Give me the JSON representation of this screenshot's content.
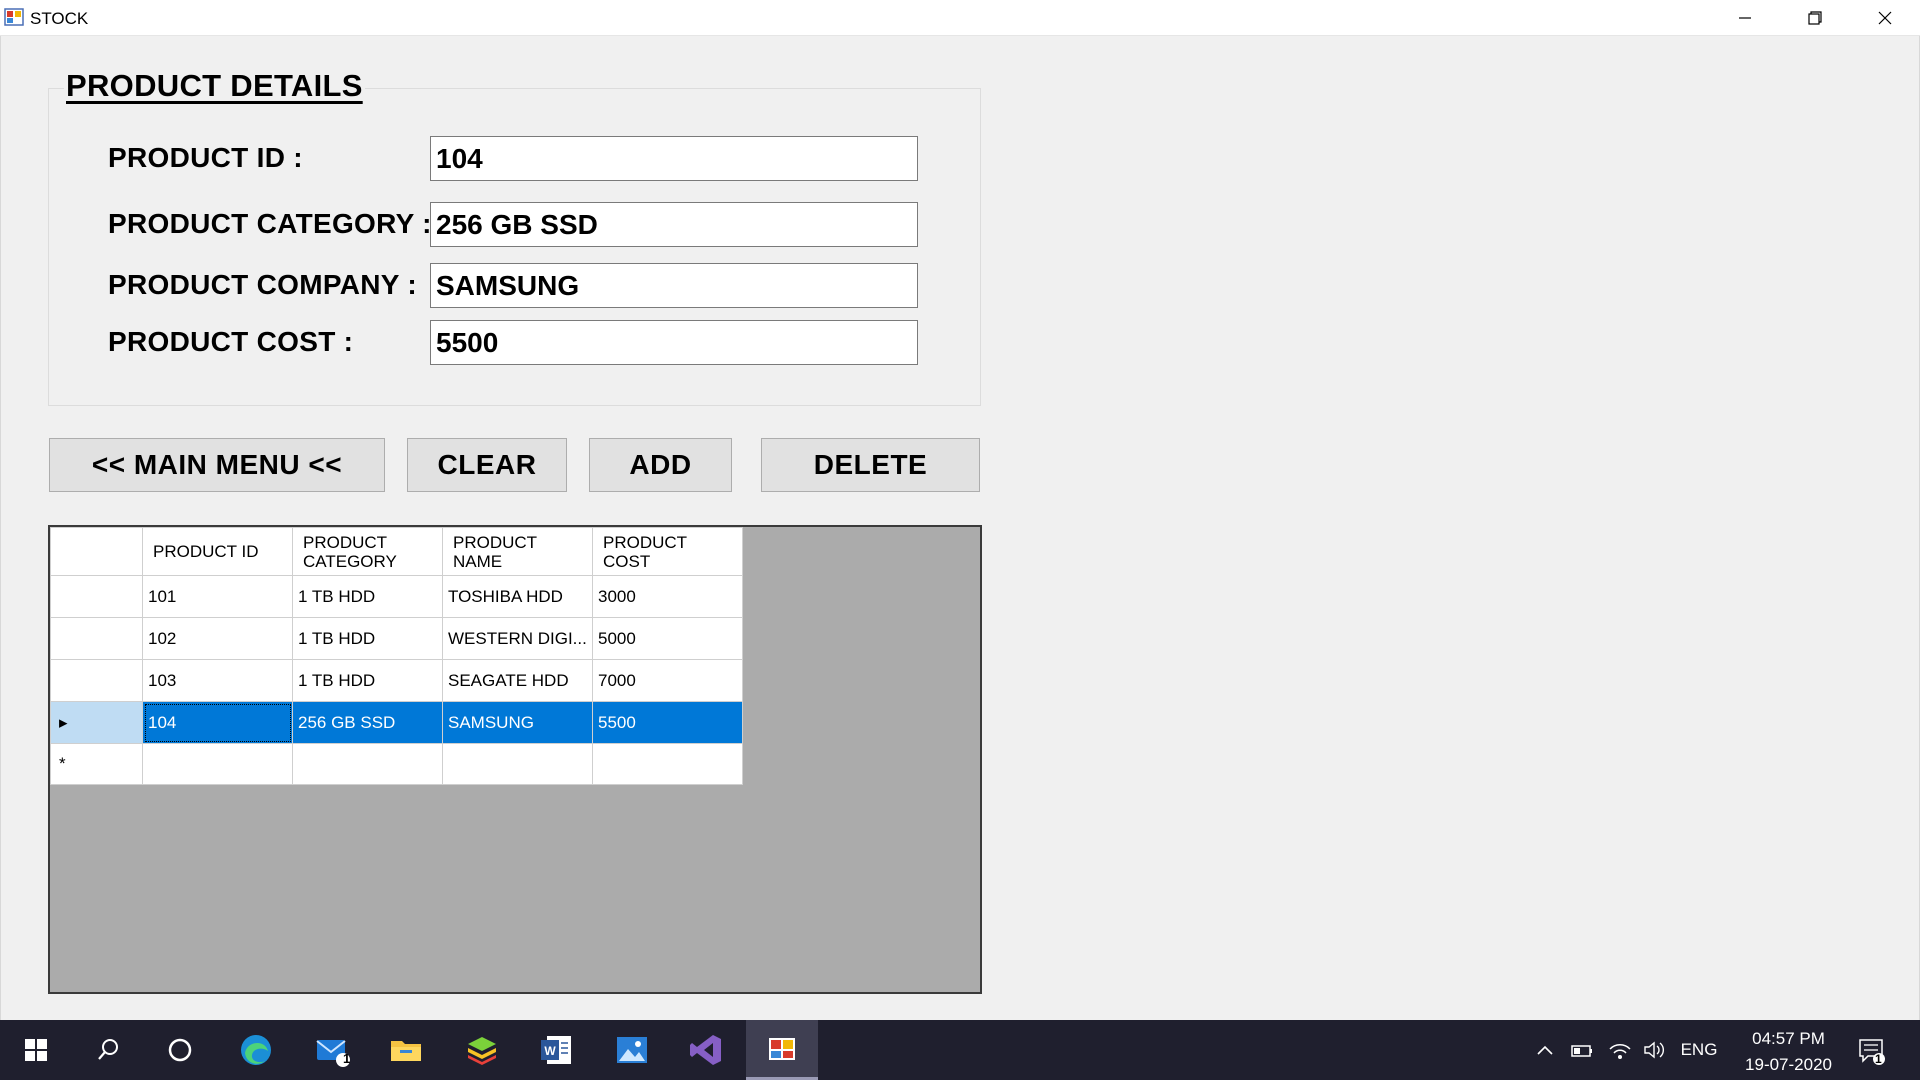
{
  "window": {
    "title": "STOCK"
  },
  "form": {
    "group_title": "PRODUCT DETAILS",
    "fields": [
      {
        "label": "PRODUCT ID :",
        "value": "104"
      },
      {
        "label": "PRODUCT CATEGORY :",
        "value": "256 GB SSD"
      },
      {
        "label": "PRODUCT COMPANY :",
        "value": "SAMSUNG"
      },
      {
        "label": "PRODUCT COST :",
        "value": "5500"
      }
    ]
  },
  "buttons": {
    "main_menu": "<< MAIN MENU <<",
    "clear": "CLEAR",
    "add": "ADD",
    "delete": "DELETE"
  },
  "grid": {
    "columns": [
      {
        "line1": "PRODUCT ID",
        "line2": ""
      },
      {
        "line1": "PRODUCT",
        "line2": "CATEGORY"
      },
      {
        "line1": "PRODUCT",
        "line2": "NAME"
      },
      {
        "line1": "PRODUCT",
        "line2": "COST"
      }
    ],
    "rows": [
      [
        "101",
        "1 TB HDD",
        "TOSHIBA HDD",
        "3000"
      ],
      [
        "102",
        "1 TB HDD",
        "WESTERN DIGI...",
        "5000"
      ],
      [
        "103",
        "1 TB HDD",
        "SEAGATE HDD",
        "7000"
      ],
      [
        "104",
        "256 GB SSD",
        "SAMSUNG",
        "5500"
      ]
    ],
    "selected_row_marker": "▸",
    "new_row_marker": "*"
  },
  "taskbar": {
    "items": [
      "windows-start-icon",
      "search-icon",
      "cortana-icon",
      "edge-icon",
      "mail-icon",
      "file-explorer-icon",
      "bluestacks-icon",
      "word-icon",
      "photos-icon",
      "visual-studio-icon",
      "stock-app-icon"
    ],
    "mail_badge": "1",
    "language": "ENG",
    "time": "04:57 PM",
    "date": "19-07-2020",
    "notification_badge": "1"
  }
}
